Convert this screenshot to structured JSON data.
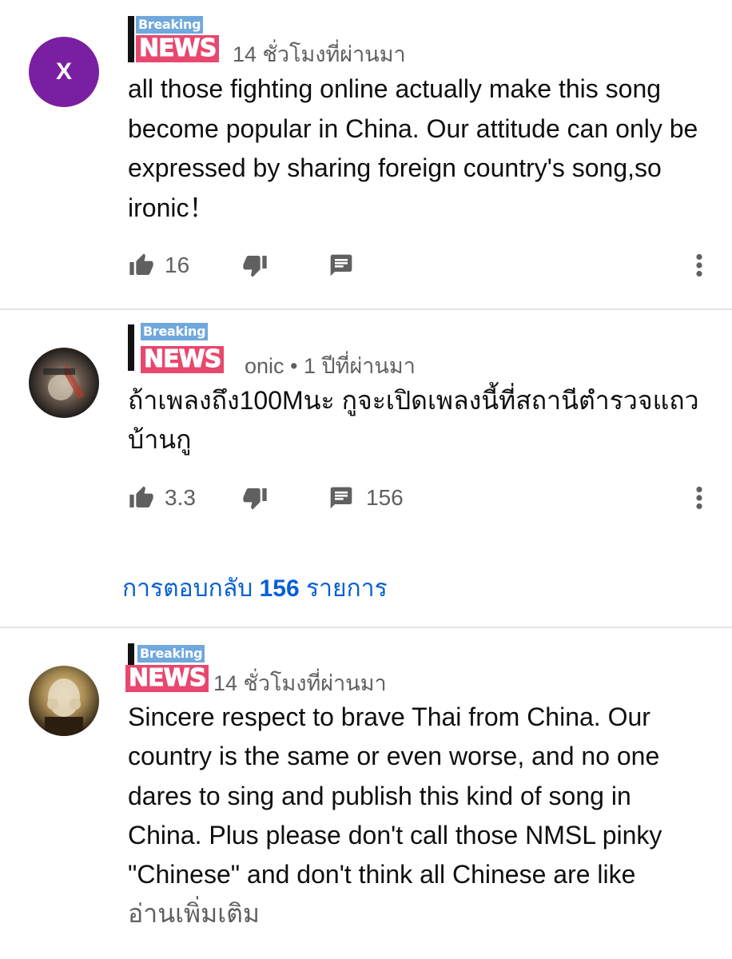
{
  "comments": [
    {
      "avatar_letter": "X",
      "badge": {
        "top": "Breaking",
        "bottom": "NEWS"
      },
      "author_fragment": "",
      "timestamp": "14 ชั่วโมงที่ผ่านมา",
      "text": "all those fighting online actually make this song become popular in China. Our attitude can only be expressed by sharing foreign country's song,so ironic！",
      "likes": "16",
      "replies": ""
    },
    {
      "avatar_letter": "",
      "badge": {
        "top": "Breaking",
        "bottom": "NEWS"
      },
      "author_fragment": "onic",
      "timestamp": "• 1 ปีที่ผ่านมา",
      "text": "ถ้าเพลงถึง100Mนะ กูจะเปิดเพลงนี้ที่สถานีตำรวจแถวบ้านกู",
      "likes": "3.3",
      "replies": "156",
      "replies_link": {
        "prefix": "การตอบกลับ",
        "count": "156",
        "suffix": "รายการ"
      }
    },
    {
      "avatar_letter": "",
      "badge": {
        "top": "Breaking",
        "bottom": "NEWS"
      },
      "author_fragment": "",
      "timestamp": "14 ชั่วโมงที่ผ่านมา",
      "text": "Sincere respect to brave Thai from China. Our country is the same or even worse, and no one dares to sing and publish this kind of song in China. Plus please don't call those NMSL pinky \"Chinese\" and don't think all Chinese are like",
      "read_more": "อ่านเพิ่มเติม"
    }
  ],
  "icons": {
    "like": "thumbs-up-icon",
    "dislike": "thumbs-down-icon",
    "reply": "comment-icon",
    "more": "more-vertical-icon"
  },
  "colors": {
    "link_blue": "#065fd4",
    "secondary_text": "#606060",
    "avatar_purple": "#7b1fa2",
    "badge_blue": "#6fa8dc",
    "badge_pink": "#e8476e"
  }
}
